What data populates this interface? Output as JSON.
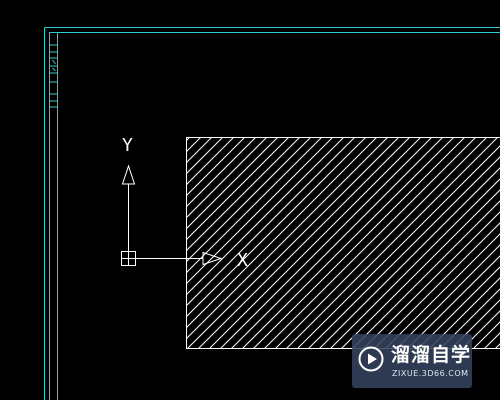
{
  "canvas": {
    "background": "#000000",
    "frame_color": "#2ad0d0",
    "line_color": "#ffffff"
  },
  "ucs": {
    "icon": "ucs-axis-icon",
    "x_label": "X",
    "y_label": "Y"
  },
  "hatch": {
    "pattern": "ANSI31",
    "color": "#ffffff"
  },
  "watermark": {
    "title": "溜溜自学",
    "subtitle": "ZIXUE.3D66.COM",
    "icon": "play-logo-icon",
    "background": "#34425c"
  }
}
